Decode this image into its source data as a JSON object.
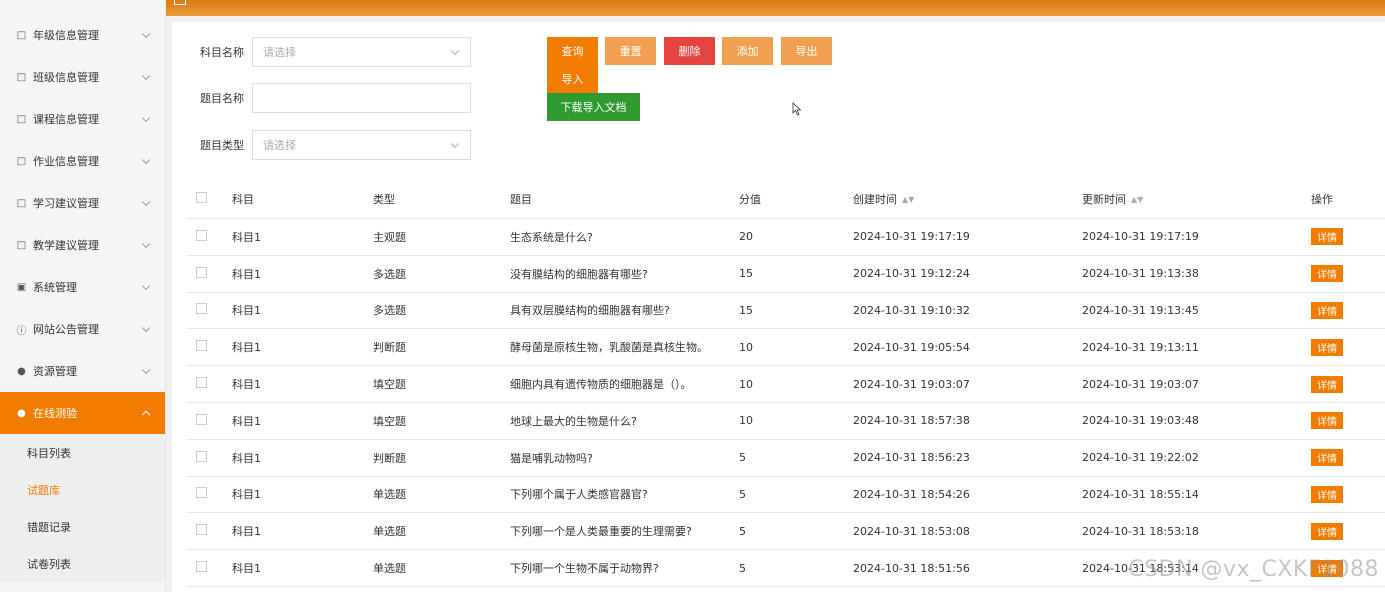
{
  "topbar": {
    "title": ""
  },
  "sidebar": {
    "items": [
      {
        "label": "年级信息管理",
        "icon": "doc-icon"
      },
      {
        "label": "班级信息管理",
        "icon": "doc-icon"
      },
      {
        "label": "课程信息管理",
        "icon": "doc-icon"
      },
      {
        "label": "作业信息管理",
        "icon": "doc-icon"
      },
      {
        "label": "学习建议管理",
        "icon": "doc-icon"
      },
      {
        "label": "教学建议管理",
        "icon": "doc-icon"
      },
      {
        "label": "系统管理",
        "icon": "image-icon"
      },
      {
        "label": "网站公告管理",
        "icon": "info-icon"
      },
      {
        "label": "资源管理",
        "icon": "pin-icon"
      },
      {
        "label": "在线测验",
        "icon": "pin-icon"
      }
    ],
    "sub_items": [
      "科目列表",
      "试题库",
      "错题记录",
      "试卷列表"
    ]
  },
  "filters": {
    "subject_label": "科目名称",
    "subject_placeholder": "请选择",
    "question_label": "题目名称",
    "question_value": "",
    "type_label": "题目类型",
    "type_placeholder": "请选择"
  },
  "buttons": {
    "query": "查询",
    "reset": "重置",
    "delete": "删除",
    "add": "添加",
    "export": "导出",
    "import": "导入",
    "download": "下载导入文档"
  },
  "table": {
    "headers": {
      "subject": "科目",
      "type": "类型",
      "title": "题目",
      "score": "分值",
      "created": "创建时间",
      "updated": "更新时间",
      "ops": "操作"
    },
    "detail_label": "详情",
    "rows": [
      {
        "subject": "科目1",
        "type": "主观题",
        "title": "生态系统是什么?",
        "score": "20",
        "created": "2024-10-31 19:17:19",
        "updated": "2024-10-31 19:17:19"
      },
      {
        "subject": "科目1",
        "type": "多选题",
        "title": "没有膜结构的细胞器有哪些?",
        "score": "15",
        "created": "2024-10-31 19:12:24",
        "updated": "2024-10-31 19:13:38"
      },
      {
        "subject": "科目1",
        "type": "多选题",
        "title": "具有双层膜结构的细胞器有哪些?",
        "score": "15",
        "created": "2024-10-31 19:10:32",
        "updated": "2024-10-31 19:13:45"
      },
      {
        "subject": "科目1",
        "type": "判断题",
        "title": "酵母菌是原核生物，乳酸菌是真核生物。",
        "score": "10",
        "created": "2024-10-31 19:05:54",
        "updated": "2024-10-31 19:13:11"
      },
      {
        "subject": "科目1",
        "type": "填空题",
        "title": "细胞内具有遗传物质的细胞器是（）。",
        "score": "10",
        "created": "2024-10-31 19:03:07",
        "updated": "2024-10-31 19:03:07"
      },
      {
        "subject": "科目1",
        "type": "填空题",
        "title": "地球上最大的生物是什么?",
        "score": "10",
        "created": "2024-10-31 18:57:38",
        "updated": "2024-10-31 19:03:48"
      },
      {
        "subject": "科目1",
        "type": "判断题",
        "title": "猫是哺乳动物吗?",
        "score": "5",
        "created": "2024-10-31 18:56:23",
        "updated": "2024-10-31 19:22:02"
      },
      {
        "subject": "科目1",
        "type": "单选题",
        "title": "下列哪个属于人类感官器官?",
        "score": "5",
        "created": "2024-10-31 18:54:26",
        "updated": "2024-10-31 18:55:14"
      },
      {
        "subject": "科目1",
        "type": "单选题",
        "title": "下列哪一个是人类最重要的生理需要?",
        "score": "5",
        "created": "2024-10-31 18:53:08",
        "updated": "2024-10-31 18:53:18"
      },
      {
        "subject": "科目1",
        "type": "单选题",
        "title": "下列哪一个生物不属于动物界?",
        "score": "5",
        "created": "2024-10-31 18:51:56",
        "updated": "2024-10-31 18:53:14"
      }
    ]
  },
  "watermark": "CSDN @vx_CXKF1088",
  "colors": {
    "accent": "#f27c00",
    "danger": "#e4433f",
    "success": "#2f9a2f",
    "light_accent": "#f0a050"
  }
}
